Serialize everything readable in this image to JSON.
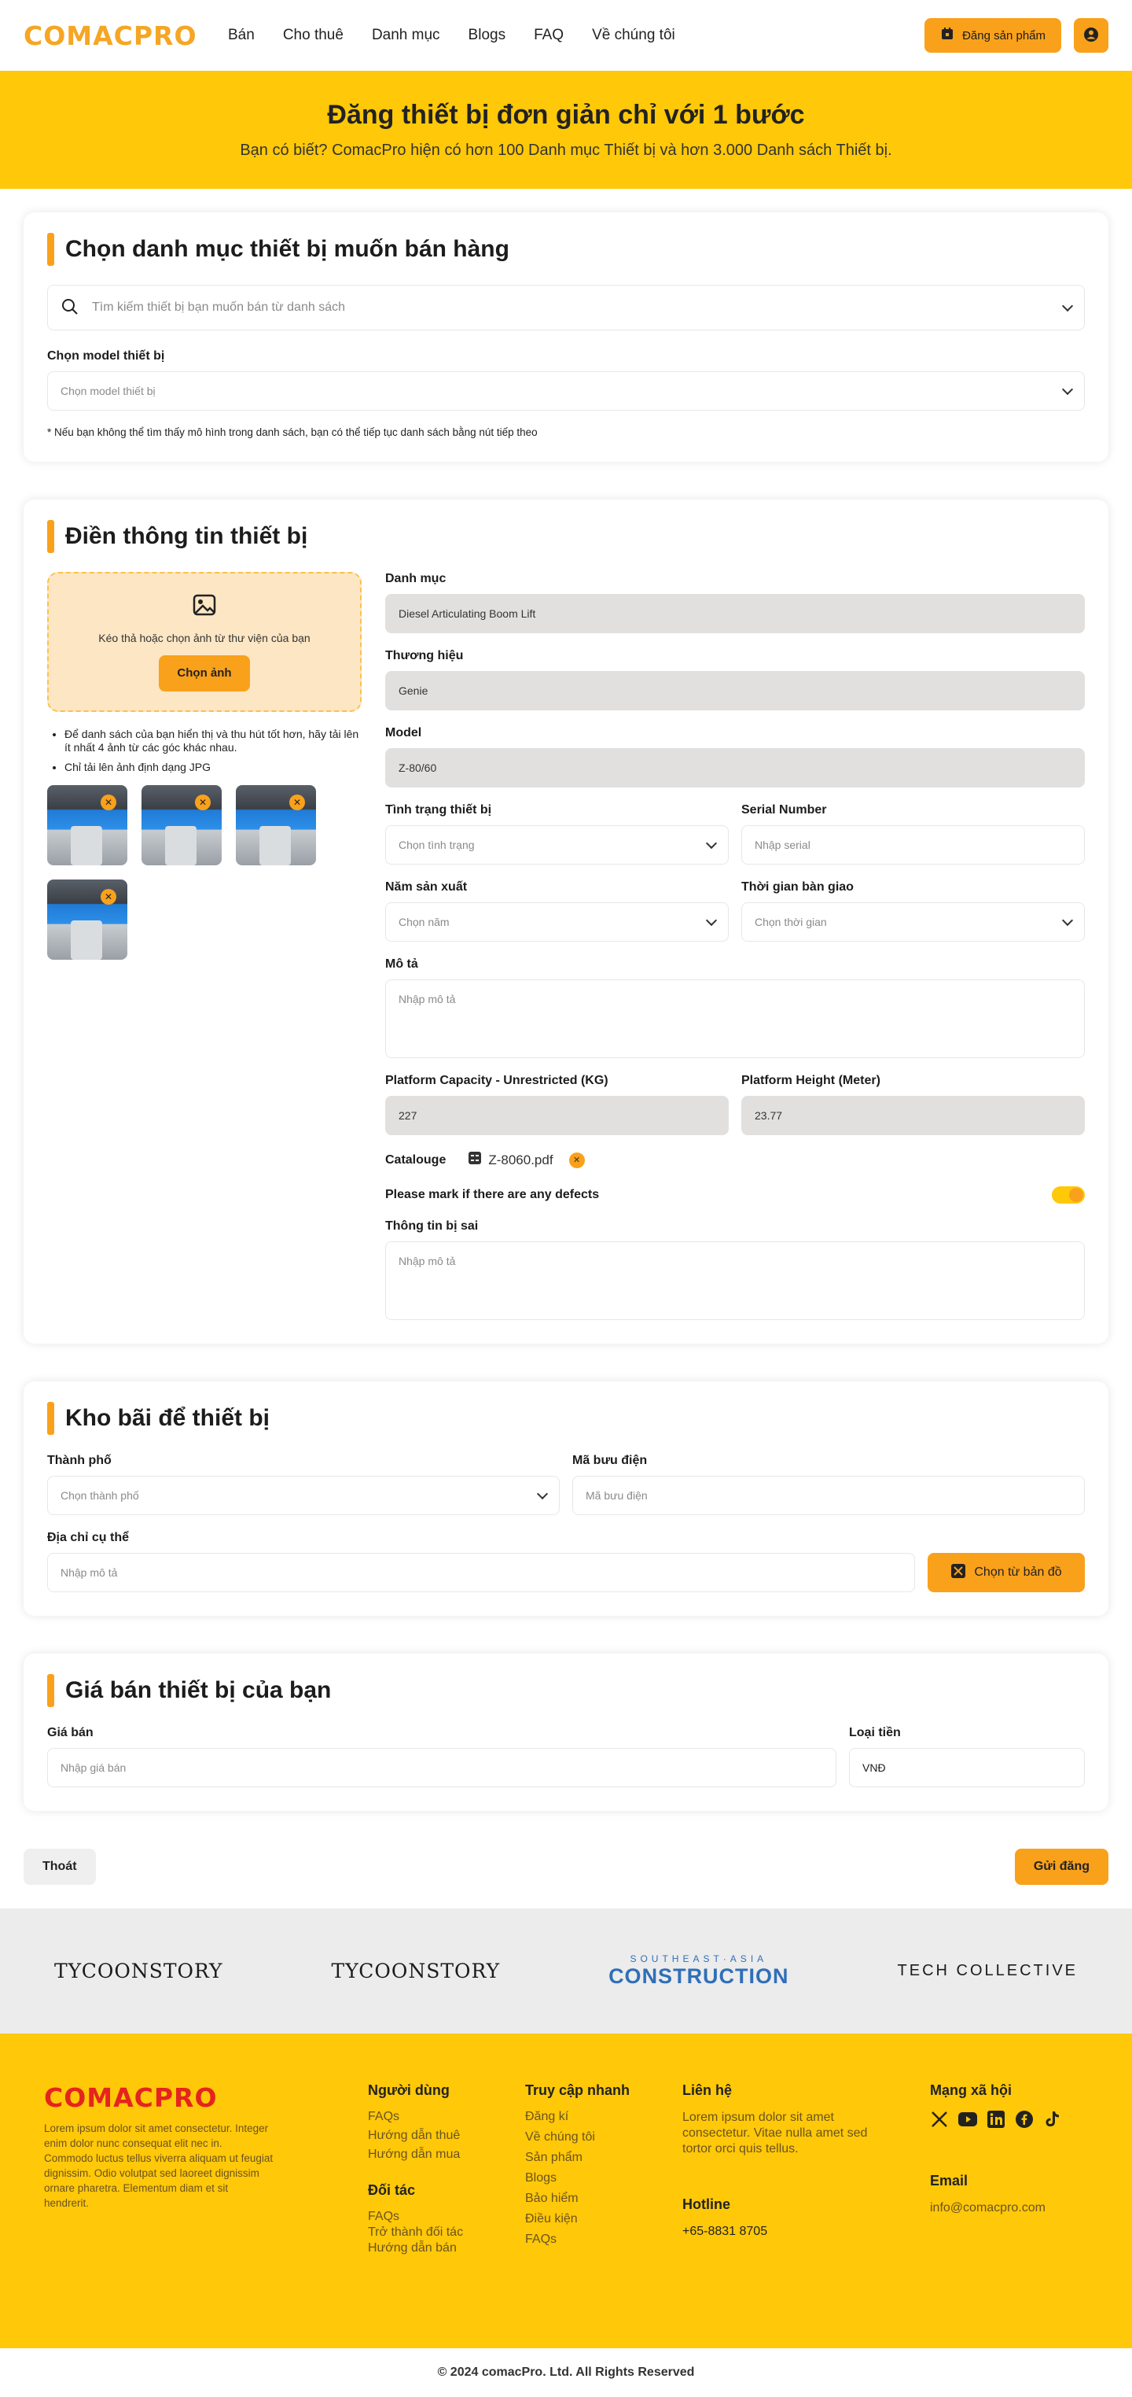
{
  "header": {
    "logo": "COMACPRO",
    "nav": [
      "Bán",
      "Cho thuê",
      "Danh mục",
      "Blogs",
      "FAQ",
      "Về chúng tôi"
    ],
    "post_button": "Đăng sản phẩm"
  },
  "hero": {
    "title": "Đăng thiết bị đơn giản chỉ với 1 bước",
    "subtitle": "Bạn có biết? ComacPro hiện có hơn 100 Danh mục Thiết bị và hơn 3.000 Danh sách Thiết bị."
  },
  "category": {
    "title": "Chọn danh mục thiết bị muốn bán hàng",
    "search_placeholder": "Tìm kiếm thiết bị bạn muốn bán từ danh sách",
    "model_label": "Chọn model thiết bị",
    "model_placeholder": "Chọn model thiết bị",
    "note": "* Nếu bạn không thể tìm thấy mô hình trong danh sách, bạn có thể tiếp tục danh sách bằng nút tiếp theo"
  },
  "details": {
    "title": "Điền thông tin thiết bị",
    "upload_text": "Kéo thả hoặc chọn ảnh từ thư viện của bạn",
    "upload_button": "Chọn ảnh",
    "tips": [
      "Để danh sách của bạn hiển thị và thu hút tốt hơn, hãy tải lên ít nhất 4 ảnh từ các góc khác nhau.",
      "Chỉ tải lên ảnh định dạng JPG"
    ],
    "category_label": "Danh mục",
    "category_value": "Diesel Articulating Boom Lift",
    "brand_label": "Thương hiệu",
    "brand_value": "Genie",
    "model_label": "Model",
    "model_value": "Z-80/60",
    "condition_label": "Tình trạng thiết bị",
    "condition_placeholder": "Chọn tình trạng",
    "serial_label": "Serial Number",
    "serial_placeholder": "Nhập serial",
    "year_label": "Năm sản xuất",
    "year_placeholder": "Chọn năm",
    "handover_label": "Thời gian bàn giao",
    "handover_placeholder": "Chọn thời gian",
    "desc_label": "Mô tả",
    "desc_placeholder": "Nhập mô tả",
    "capacity_label": "Platform Capacity - Unrestricted (KG)",
    "capacity_value": "227",
    "height_label": "Platform Height (Meter)",
    "height_value": "23.77",
    "catalogue_label": "Catalouge",
    "catalogue_file": "Z-8060.pdf",
    "defects_label": "Please mark if there are any defects",
    "wrong_info_label": "Thông tin bị sai",
    "wrong_info_placeholder": "Nhập mô tả"
  },
  "storage": {
    "title": "Kho bãi để thiết bị",
    "city_label": "Thành phố",
    "city_placeholder": "Chọn thành phố",
    "zip_label": "Mã bưu điện",
    "zip_placeholder": "Mã bưu điện",
    "address_label": "Địa chỉ cụ thể",
    "address_placeholder": "Nhập mô tả",
    "map_button": "Chọn từ bản đồ"
  },
  "price": {
    "title": "Giá bán thiết bị của bạn",
    "price_label": "Giá bán",
    "price_placeholder": "Nhập giá bán",
    "currency_label": "Loại tiền",
    "currency_value": "VNĐ"
  },
  "actions": {
    "exit": "Thoát",
    "submit": "Gửi đăng"
  },
  "partners": {
    "tycoon": "TYCOONSTORY",
    "sea_top": "SOUTHEAST·ASIA",
    "sea_bottom": "CONSTRUCTION",
    "tech": "TECH COLLECTIVE"
  },
  "footer": {
    "logo": "COMACPRO",
    "description": "Lorem ipsum dolor sit amet consectetur. Integer enim dolor nunc consequat elit nec in. Commodo luctus tellus viverra aliquam ut feugiat dignissim. Odio volutpat sed laoreet dignissim ornare pharetra. Elementum diam et sit hendrerit.",
    "users_title": "Người dùng",
    "users_links": [
      "FAQs",
      "Hướng dẫn thuê",
      "Hướng dẫn mua"
    ],
    "partners_title": "Đối tác",
    "partners_links": [
      "FAQs",
      "Trở thành đối tác",
      "Hướng dẫn bán"
    ],
    "quick_title": "Truy cập nhanh",
    "quick_links": [
      "Đăng kí",
      "Về chúng tôi",
      "Sản phẩm",
      "Blogs",
      "Bảo hiểm",
      "Điều kiện",
      "FAQs"
    ],
    "contact_title": "Liên hệ",
    "contact_text": "Lorem ipsum dolor sit amet consectetur. Vitae nulla amet sed tortor orci quis tellus.",
    "hotline_title": "Hotline",
    "hotline": "+65-8831 8705",
    "social_title": "Mạng xã hội",
    "email_title": "Email",
    "email": "info@comacpro.com",
    "copyright": "© 2024 comacPro. Ltd. All Rights Reserved"
  }
}
